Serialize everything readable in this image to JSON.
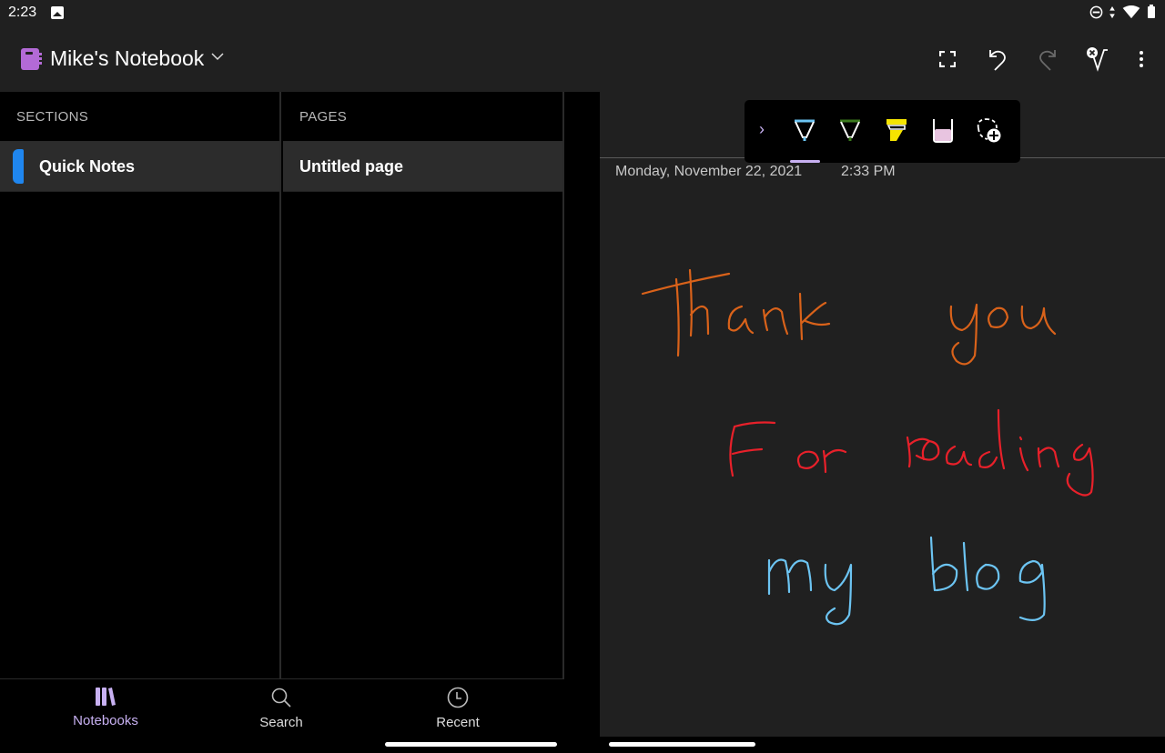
{
  "status_bar": {
    "time": "2:23",
    "icons": [
      "gallery-icon",
      "do-not-disturb-icon",
      "data-arrows-icon",
      "wifi-icon",
      "battery-icon"
    ],
    "wifi_badge": "4"
  },
  "header": {
    "notebook_name": "Mike's Notebook",
    "notebook_color": "#b36ad6",
    "chevron": "∨",
    "actions": [
      "fullscreen-icon",
      "undo-icon",
      "redo-icon",
      "ink-to-shape-icon",
      "more-options-icon"
    ]
  },
  "sections": {
    "header": "SECTIONS",
    "items": [
      {
        "label": "Quick Notes",
        "color": "#1f86ef",
        "selected": true
      }
    ]
  },
  "pages": {
    "header": "PAGES",
    "items": [
      {
        "label": "Untitled page",
        "selected": true
      }
    ]
  },
  "bottom_nav": {
    "items": [
      {
        "label": "Notebooks",
        "icon": "notebooks-icon",
        "active": true
      },
      {
        "label": "Search",
        "icon": "search-icon",
        "active": false
      },
      {
        "label": "Recent",
        "icon": "clock-icon",
        "active": false
      }
    ]
  },
  "page": {
    "date": "Monday, November 22, 2021",
    "time": "2:33 PM",
    "ink_lines": [
      {
        "text": "Thank you",
        "color": "#d9621a"
      },
      {
        "text": "For reading",
        "color": "#e8202a"
      },
      {
        "text": "my blog",
        "color": "#6cc4f2"
      }
    ]
  },
  "pen_toolbar": {
    "expand_glyph": "›",
    "tools": [
      {
        "name": "pen-light-blue",
        "color": "#6cc4f2",
        "selected": true
      },
      {
        "name": "pen-green",
        "color": "#3b7a1e",
        "selected": false
      },
      {
        "name": "highlighter-yellow",
        "color": "#f5e400",
        "selected": false
      },
      {
        "name": "highlighter-pink",
        "color": "#e8c4e0",
        "selected": false
      },
      {
        "name": "lasso-select-add",
        "color": "#ffffff",
        "selected": false
      }
    ],
    "accent": "#c8b1f2"
  }
}
